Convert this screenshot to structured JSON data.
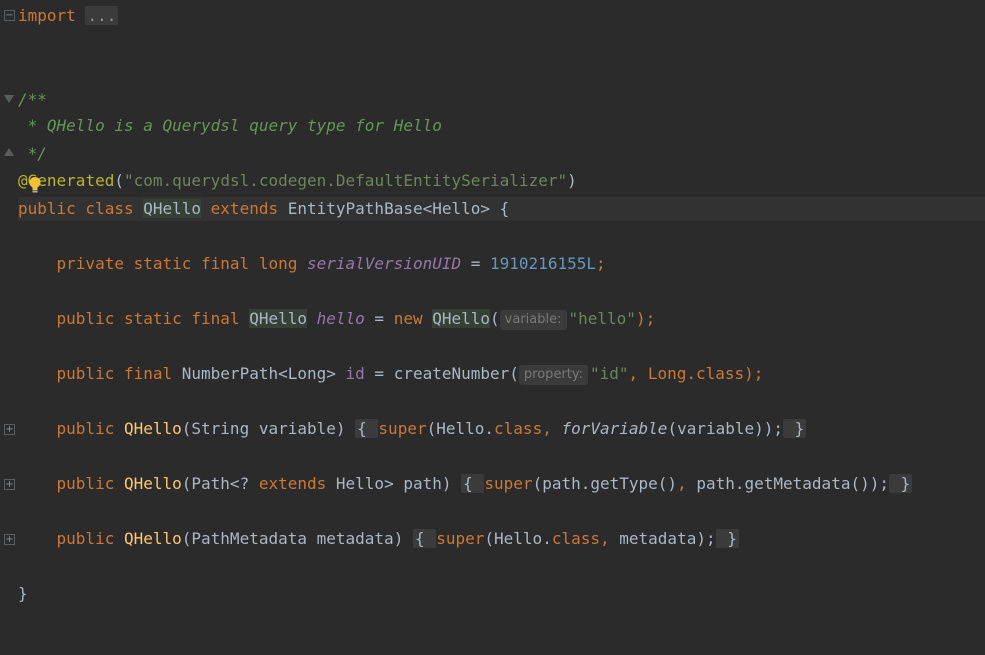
{
  "editor": {
    "language": "java",
    "lines": {
      "l1_import": "import",
      "l1_collapsed": "...",
      "l4_comment_open": "/**",
      "l5_comment": " * QHello is a Querydsl query type for Hello",
      "l6_comment_close": " */",
      "l7_at": "@",
      "l7_annotation": "Generated",
      "l7_open": "(",
      "l7_string": "\"com.querydsl.codegen.DefaultEntitySerializer\"",
      "l7_close": ")",
      "l8_kw": "public class ",
      "l8_class": "QHello",
      "l8_extends": " extends ",
      "l8_rest": "EntityPathBase<Hello> {",
      "l10_kw": "private static final long ",
      "l10_field": "serialVersionUID",
      "l10_eq": " = ",
      "l10_num": "1910216155L",
      "l10_semi": ";",
      "l12_kw": "public static final ",
      "l12_type": "QHello",
      "l12_field": "hello",
      "l12_eq": " = ",
      "l12_new": "new ",
      "l12_ctor": "QHello",
      "l12_paren": "(",
      "l12_hint": "variable:",
      "l12_str": "\"hello\"",
      "l12_end": ");",
      "l14_kw": "public final ",
      "l14_type": "NumberPath<Long> ",
      "l14_field": "id",
      "l14_eq": " = createNumber(",
      "l14_hint": "property:",
      "l14_str": "\"id\"",
      "l14_comma": ", Long.",
      "l14_class": "class",
      "l14_end": ");",
      "l16_kw": "public ",
      "l16_name": "QHello",
      "l16_params": "(String variable) ",
      "l16_open": "{ ",
      "l16_super": "super",
      "l16_args1": "(Hello.",
      "l16_class": "class",
      "l16_comma": ", ",
      "l16_method": "forVariable",
      "l16_args2": "(variable));",
      "l16_close": " }",
      "l18_kw": "public ",
      "l18_name": "QHello",
      "l18_p1": "(Path<? ",
      "l18_extends": "extends",
      "l18_p2": " Hello> path) ",
      "l18_open": "{ ",
      "l18_super": "super",
      "l18_args1": "(path.getType()",
      "l18_comma": ", ",
      "l18_args2": "path.getMetadata());",
      "l18_close": " }",
      "l20_kw": "public ",
      "l20_name": "QHello",
      "l20_params": "(PathMetadata metadata) ",
      "l20_open": "{ ",
      "l20_super": "super",
      "l20_args1": "(Hello.",
      "l20_class": "class",
      "l20_comma": ", ",
      "l20_args2": "metadata);",
      "l20_close": " }",
      "l22_brace": "}"
    }
  },
  "colors": {
    "background": "#2b2b2b",
    "keyword": "#cc7832",
    "comment": "#629755",
    "string": "#6a8759",
    "number": "#6897bb",
    "field": "#9876aa",
    "method": "#ffc66d",
    "annotation": "#bbb529",
    "text": "#a9b7c6"
  },
  "icons": {
    "intention": "lightbulb-icon",
    "fold": "fold-toggle-icon"
  }
}
